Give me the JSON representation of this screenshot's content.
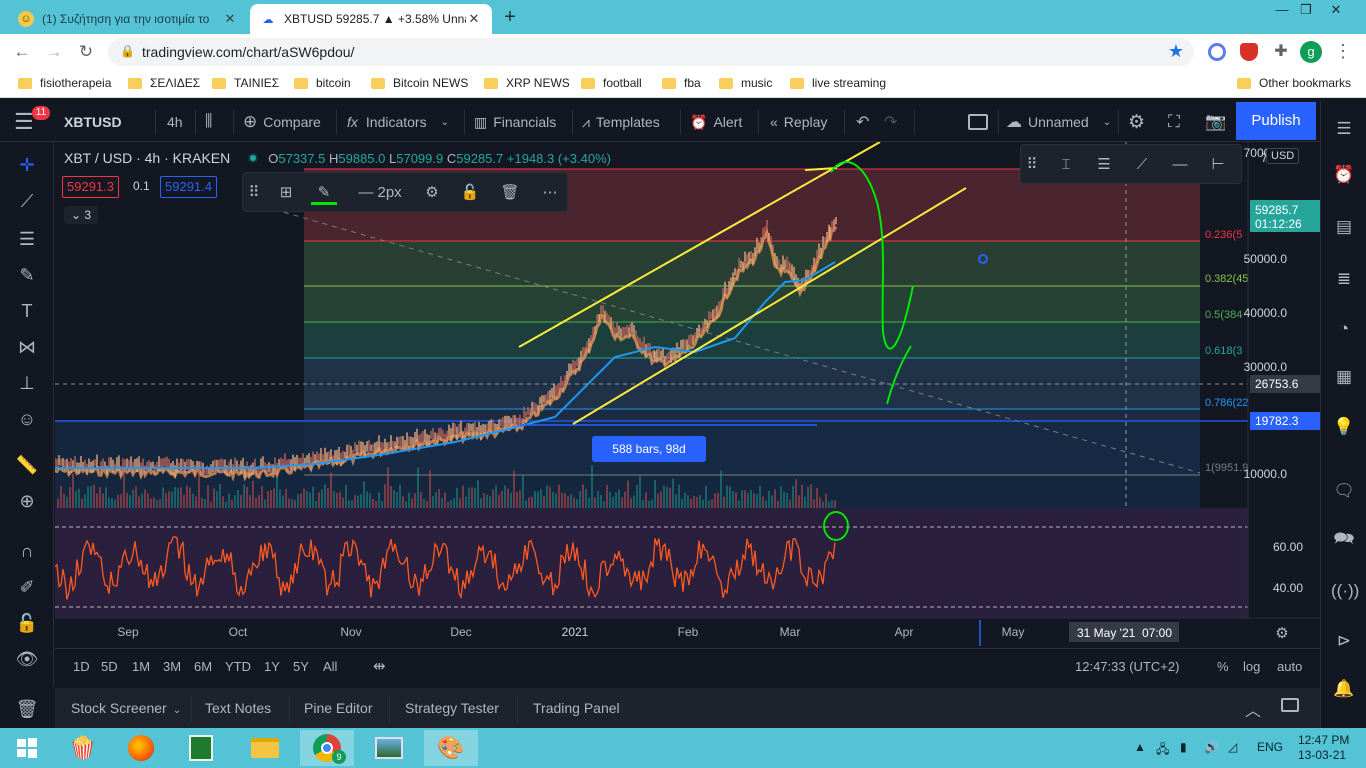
{
  "browser": {
    "tabs": [
      {
        "title": "(1) Συζήτηση για την ισοτιμία το",
        "active": false
      },
      {
        "title": "XBTUSD 59285.7 ▲ +3.58% Unnamed",
        "active": true
      }
    ],
    "url": "tradingview.com/chart/aSW6pdou/",
    "profile_initial": "g",
    "bookmarks": [
      "fisiotherapeia",
      "ΣΕΛΙΔΕΣ",
      "ΤΑΙΝΙΕΣ",
      "bitcoin",
      "Bitcoin NEWS",
      "XRP NEWS",
      "football",
      "fba",
      "music",
      "live streaming"
    ],
    "other_bookmarks": "Other bookmarks"
  },
  "toolbar": {
    "symbol": "XBTUSD",
    "interval": "4h",
    "compare": "Compare",
    "indicators": "Indicators",
    "financials": "Financials",
    "templates": "Templates",
    "alert": "Alert",
    "replay": "Replay",
    "layout_name": "Unnamed",
    "publish": "Publish",
    "notification_count": "11"
  },
  "legend": {
    "title": "XBT / USD · 4h · KRAKEN",
    "o_label": "O",
    "open": "57337.5",
    "h_label": "H",
    "high": "59885.0",
    "l_label": "L",
    "low": "57099.9",
    "c_label": "C",
    "close": "59285.7",
    "change": "+1948.3 (+3.40%)",
    "bid": "59291.3",
    "spread": "0.1",
    "ask": "59291.4",
    "indicator_count": "3"
  },
  "drawing_toolbar": {
    "width_label": "2px"
  },
  "chart": {
    "currency": "USD",
    "price_axis": [
      "70000.0",
      "50000.0",
      "40000.0",
      "30000.0",
      "10000.0"
    ],
    "price_axis_prefix": "7",
    "last_price": "59285.7",
    "countdown": "01:12:26",
    "crosshair_price": "26753.6",
    "hline_price": "19782.3",
    "fib_labels": [
      "0.236(5",
      "0.382(45",
      "0.5(384",
      "0.618(3",
      "0.786(22",
      "1(9951.9"
    ],
    "range_tooltip": "588 bars, 98d",
    "rsi_axis": [
      "60.00",
      "40.00"
    ],
    "time_axis": [
      "Sep",
      "Oct",
      "Nov",
      "Dec",
      "2021",
      "Feb",
      "Mar",
      "Apr",
      "May"
    ],
    "crosshair_date": "31 May '21",
    "crosshair_time": "07:00",
    "colors": {
      "bg": "#131722",
      "fib_red": "#f23645",
      "fib_green": "#4caf50",
      "ema": "#2196f3",
      "channel": "#ffeb3b",
      "hand": "#00e600",
      "rsi": "#ff5a1f"
    }
  },
  "range_bar": {
    "ranges": [
      "1D",
      "5D",
      "1M",
      "3M",
      "6M",
      "YTD",
      "1Y",
      "5Y",
      "All"
    ],
    "time": "12:47:33 (UTC+2)",
    "percent": "%",
    "log": "log",
    "auto": "auto"
  },
  "bottom_panel": [
    "Stock Screener",
    "Text Notes",
    "Pine Editor",
    "Strategy Tester",
    "Trading Panel"
  ],
  "taskbar": {
    "language": "ENG",
    "time": "12:47 PM",
    "date": "13-03-21",
    "chrome_badge": "9"
  }
}
